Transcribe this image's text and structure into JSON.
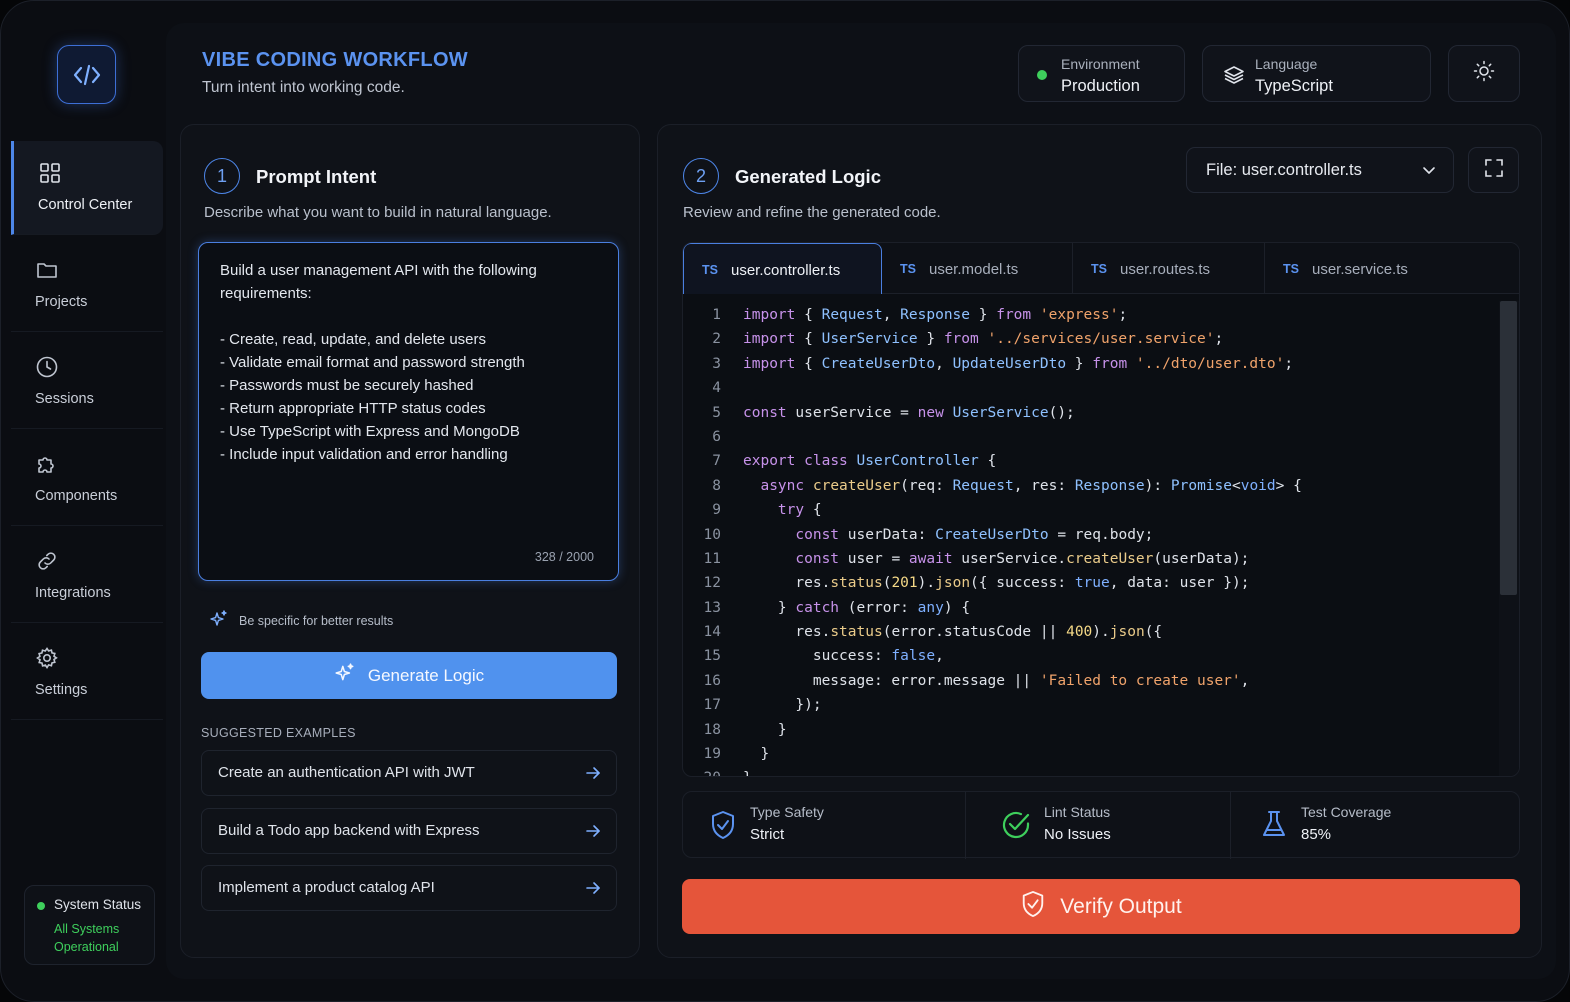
{
  "header": {
    "title": "VIBE CODING WORKFLOW",
    "subtitle": "Turn intent into working code.",
    "environment": {
      "label": "Environment",
      "value": "Production"
    },
    "language": {
      "label": "Language",
      "value": "TypeScript"
    },
    "theme_icon": "sun-icon"
  },
  "sidebar": {
    "logo_icon": "code-icon",
    "items": [
      {
        "label": "Control Center",
        "icon": "grid-icon",
        "active": true
      },
      {
        "label": "Projects",
        "icon": "folder-icon",
        "active": false
      },
      {
        "label": "Sessions",
        "icon": "clock-icon",
        "active": false
      },
      {
        "label": "Components",
        "icon": "puzzle-icon",
        "active": false
      },
      {
        "label": "Integrations",
        "icon": "link-icon",
        "active": false
      },
      {
        "label": "Settings",
        "icon": "gear-icon",
        "active": false
      }
    ],
    "status": {
      "title": "System Status",
      "value": "All Systems Operational"
    }
  },
  "prompt": {
    "step": "1",
    "title": "Prompt Intent",
    "subtitle": "Describe what you want to build in natural language.",
    "text": "Build a user management API with the following requirements:\n\n- Create, read, update, and delete users\n- Validate email format and password strength\n- Passwords must be securely hashed\n- Return appropriate HTTP status codes\n- Use TypeScript with Express and MongoDB\n- Include input validation and error handling",
    "char_count": "328 / 2000",
    "tip": "Be specific for better results",
    "generate_label": "Generate Logic",
    "suggested_heading": "SUGGESTED EXAMPLES",
    "suggestions": [
      "Create an authentication API with JWT",
      "Build a Todo app backend with Express",
      "Implement a product catalog API"
    ]
  },
  "logic": {
    "step": "2",
    "title": "Generated Logic",
    "subtitle": "Review and refine the generated code.",
    "file_label": "File:  user.controller.ts",
    "tabs": [
      {
        "badge": "TS",
        "name": "user.controller.ts",
        "active": true
      },
      {
        "badge": "TS",
        "name": "user.model.ts",
        "active": false
      },
      {
        "badge": "TS",
        "name": "user.routes.ts",
        "active": false
      },
      {
        "badge": "TS",
        "name": "user.service.ts",
        "active": false
      }
    ],
    "code_lines": [
      "import { Request, Response } from 'express';",
      "import { UserService } from '../services/user.service';",
      "import { CreateUserDto, UpdateUserDto } from '../dto/user.dto';",
      "",
      "const userService = new UserService();",
      "",
      "export class UserController {",
      "  async createUser(req: Request, res: Response): Promise<void> {",
      "    try {",
      "      const userData: CreateUserDto = req.body;",
      "      const user = await userService.createUser(userData);",
      "      res.status(201).json({ success: true, data: user });",
      "    } catch (error: any) {",
      "      res.status(error.statusCode || 400).json({",
      "        success: false,",
      "        message: error.message || 'Failed to create user',",
      "      });",
      "    }",
      "  }",
      "}"
    ],
    "metrics": [
      {
        "label": "Type Safety",
        "value": "Strict",
        "icon": "shield-icon"
      },
      {
        "label": "Lint Status",
        "value": "No Issues",
        "icon": "check-circle-icon"
      },
      {
        "label": "Test Coverage",
        "value": "85%",
        "icon": "flask-icon"
      }
    ],
    "verify_label": "Verify Output"
  },
  "colors": {
    "accent": "#5092ee",
    "verify": "#e5553a",
    "success": "#3ecf5c"
  }
}
